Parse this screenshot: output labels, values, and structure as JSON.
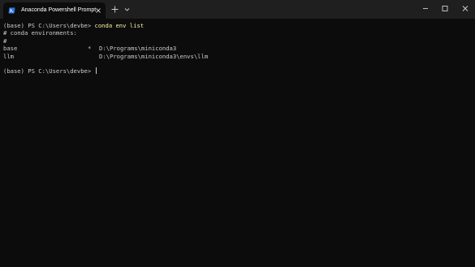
{
  "window": {
    "tab_title": "Anaconda Powershell Prompt",
    "icons": {
      "tab": "powershell-icon",
      "tab_close": "close-icon",
      "new_tab": "plus-icon",
      "dropdown": "chevron-down-icon",
      "minimize": "minimize-icon",
      "maximize": "maximize-icon",
      "close": "close-icon"
    }
  },
  "terminal": {
    "prompt1": "(base) PS C:\\Users\\devbe> ",
    "command1": "conda env list",
    "header1": "# conda environments:",
    "header2": "#",
    "envs": [
      {
        "name": "base",
        "active_marker": "*",
        "path": "D:\\Programs\\miniconda3"
      },
      {
        "name": "llm",
        "active_marker": "",
        "path": "D:\\Programs\\miniconda3\\envs\\llm"
      }
    ],
    "prompt2": "(base) PS C:\\Users\\devbe> "
  },
  "colors": {
    "background": "#0c0c0c",
    "titlebar": "#1f1f1f",
    "text": "#cccccc",
    "command": "#f9f1a5",
    "icon_accent": "#2c7be5"
  }
}
